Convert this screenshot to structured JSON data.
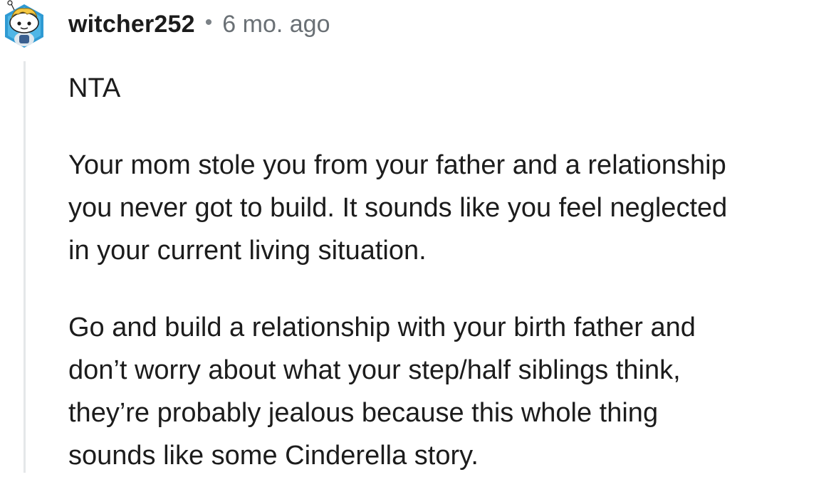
{
  "comment": {
    "author": "witcher252",
    "separator": "•",
    "age": "6 mo. ago",
    "paragraphs": [
      [
        "NTA"
      ],
      [
        "Your mom stole you from your father and a relationship",
        "you never got to build. It sounds like you feel neglected",
        "in your current living situation."
      ],
      [
        "Go and build a relationship with your birth father and",
        "don’t worry about what your step/half siblings think,",
        "they’re probably jealous because this whole thing",
        "sounds like some Cinderella story."
      ]
    ]
  },
  "icons": {
    "avatar": "snoo-avatar-icon"
  },
  "colors": {
    "text": "#1c1c1c",
    "meta": "#6a7075",
    "thread_line": "#e5e7e9",
    "avatar_bg": "#2f9ad3"
  }
}
